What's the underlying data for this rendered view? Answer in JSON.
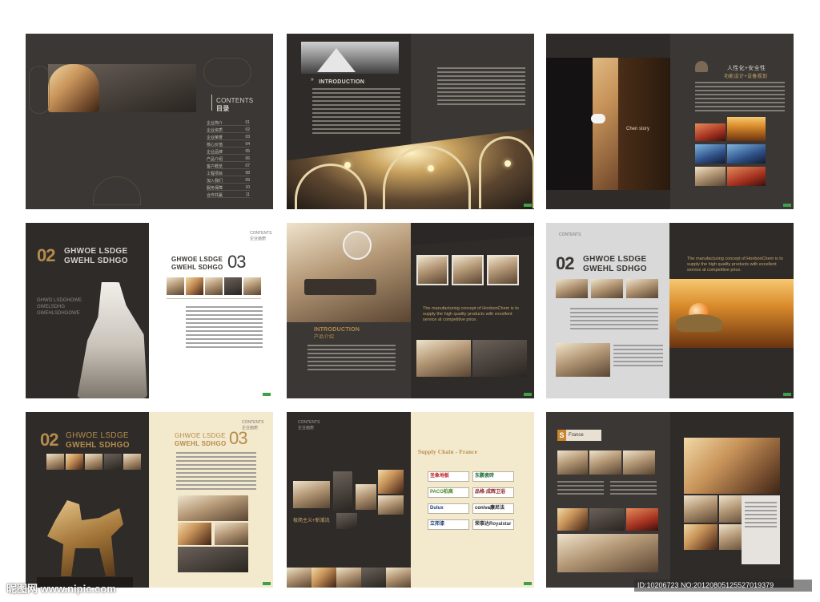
{
  "spread1": {
    "contents_en": "CONTENTS",
    "contents_cn": "目录",
    "toc": [
      {
        "label": "企业简介",
        "num": "01"
      },
      {
        "label": "企业资质",
        "num": "02"
      },
      {
        "label": "企业荣誉",
        "num": "03"
      },
      {
        "label": "核心价值",
        "num": "04"
      },
      {
        "label": "企业品牌",
        "num": "05"
      },
      {
        "label": "产品介绍",
        "num": "06"
      },
      {
        "label": "客户概览",
        "num": "07"
      },
      {
        "label": "工程项目",
        "num": "08"
      },
      {
        "label": "加入我们",
        "num": "09"
      },
      {
        "label": "服务保障",
        "num": "10"
      },
      {
        "label": "合作共赢",
        "num": "11"
      }
    ]
  },
  "spread2": {
    "intro": "INTRODUCTION"
  },
  "spread3": {
    "cn_heading_1": "人性化+安全性",
    "cn_heading_2": "功能设计+设备规划",
    "caption": "Chen story"
  },
  "spread4": {
    "num": "02",
    "headline_1": "GHWOE LSDGE",
    "headline_2": "GWEHL SDHGO",
    "sub_1": "GHWO LSDGHOWE",
    "sub_2": "GWELSDHG",
    "sub_3": "GWEHLSDHGOWE",
    "right_headline_1": "GHWOE LSDGE",
    "right_headline_2": "GWEHL SDHGO",
    "right_num": "03",
    "contents_mark": "CONTENTS",
    "contents_mark_cn": "企业画册"
  },
  "spread5": {
    "intro": "INTRODUCTION",
    "intro_cn": "产品介绍",
    "tagline": "The manufacturing concept of HonbonChem is to supply the high quality products with excellent service at competitive price."
  },
  "spread6": {
    "num": "02",
    "headline_1": "GHWOE LSDGE",
    "headline_2": "GWEHL SDHGO",
    "tagline": "The manufacturing concept of HonbonChem is to supply the high quality products with excellent service at competitive price."
  },
  "spread7": {
    "num": "02",
    "headline_1": "GHWOE LSDGE",
    "headline_2": "GWEHL SDHGO",
    "right_headline_1": "GHWOE LSDGE",
    "right_headline_2": "GWEHL SDHGO",
    "right_num": "03",
    "contents_mark": "CONTENTS",
    "contents_mark_cn": "企业画册"
  },
  "spread8": {
    "supply_chain": "Supply Chain - France",
    "slogan": "极简主义+新潮流",
    "brands": [
      "圣象地板",
      "东鹏瓷砖",
      "PACO柏高",
      "品格·成辉卫浴",
      "Dulux",
      "coniva康尼法",
      "立邦漆",
      "荣事达Royalstar"
    ],
    "contents_mark": "CONTENTS",
    "contents_mark_cn": "企业画册"
  },
  "spread9": {
    "badge_letter": "S",
    "badge_word": "France"
  },
  "watermark": {
    "site": "昵图网 www.nipic.com",
    "id": "ID:10206723 NO:20120805125527019379"
  },
  "colors": {
    "page_dark": "#3a3735",
    "gold": "#b58b4c",
    "cream": "#f3e9cd",
    "tag_green": "#3fa04a"
  }
}
